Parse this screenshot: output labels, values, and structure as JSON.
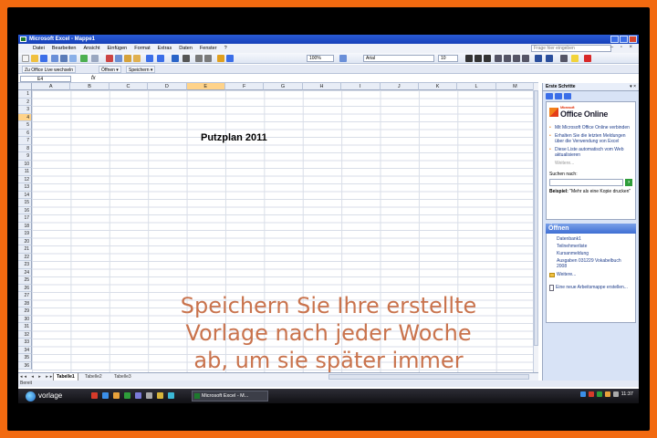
{
  "window": {
    "title": "Microsoft Excel - Mappe1"
  },
  "menu": {
    "items": [
      "Datei",
      "Bearbeiten",
      "Ansicht",
      "Einfügen",
      "Format",
      "Extras",
      "Daten",
      "Fenster",
      "?"
    ],
    "help_placeholder": "Frage hier eingeben"
  },
  "toolbar": {
    "zoom": "100%",
    "font": "Arial",
    "font_size": "10"
  },
  "toolbar2": {
    "office_live": "Zu Office Live wechseln",
    "open": "Öffnen ▾",
    "save": "Speichern ▾"
  },
  "formula_bar": {
    "name_box": "E4",
    "fx": "fx",
    "content": ""
  },
  "grid": {
    "columns": [
      "A",
      "B",
      "C",
      "D",
      "E",
      "F",
      "G",
      "H",
      "I",
      "J",
      "K",
      "L",
      "M"
    ],
    "rows": [
      "1",
      "2",
      "3",
      "4",
      "5",
      "6",
      "7",
      "8",
      "9",
      "10",
      "11",
      "12",
      "13",
      "14",
      "15",
      "16",
      "17",
      "18",
      "19",
      "20",
      "21",
      "22",
      "23",
      "24",
      "25",
      "26",
      "27",
      "28",
      "29",
      "30",
      "31",
      "32",
      "33",
      "34",
      "35",
      "36"
    ],
    "active_col": "E",
    "active_row": "4",
    "title_cell": "Putzplan 2011"
  },
  "sheets": {
    "tabs": [
      "Tabelle1",
      "Tabelle2",
      "Tabelle3"
    ],
    "active": "Tabelle1"
  },
  "status": {
    "text": "Bereit"
  },
  "task_pane": {
    "title": "Erste Schritte",
    "office_online_small": "Microsoft",
    "office_online": "Office Online",
    "links": [
      "Mit Microsoft Office Online verbinden",
      "Erhalten Sie die letzten Meldungen über die Verwendung von Excel",
      "Diese Liste automatisch vom Web aktualisieren"
    ],
    "more": "Weitere...",
    "search_label": "Suchen nach:",
    "example_label": "Beispiel:",
    "example_text": "\"Mehr als eine Kopie drucken\"",
    "open_header": "Öffnen",
    "files": [
      "Datenbank1",
      "Teilnehmerliste",
      "Kursanmeldung",
      "Ausgaben 031229 Vokabelbuch 2008"
    ],
    "files_more": "Weitere...",
    "new_workbook": "Eine neue Arbeitsmappe erstellen..."
  },
  "taskbar": {
    "start_label": "vorlage",
    "excel_task": "Microsoft Excel - M...",
    "clock": "11:37"
  },
  "caption": {
    "lines": [
      "Speichern Sie Ihre erstellte",
      "Vorlage nach jeder Woche",
      "ab, um sie später immer"
    ]
  },
  "colors": {
    "frame_orange": "#f26a10",
    "title_bar": "#1640b8",
    "caption_text": "#c9734d",
    "active_header": "#ffd38a"
  }
}
